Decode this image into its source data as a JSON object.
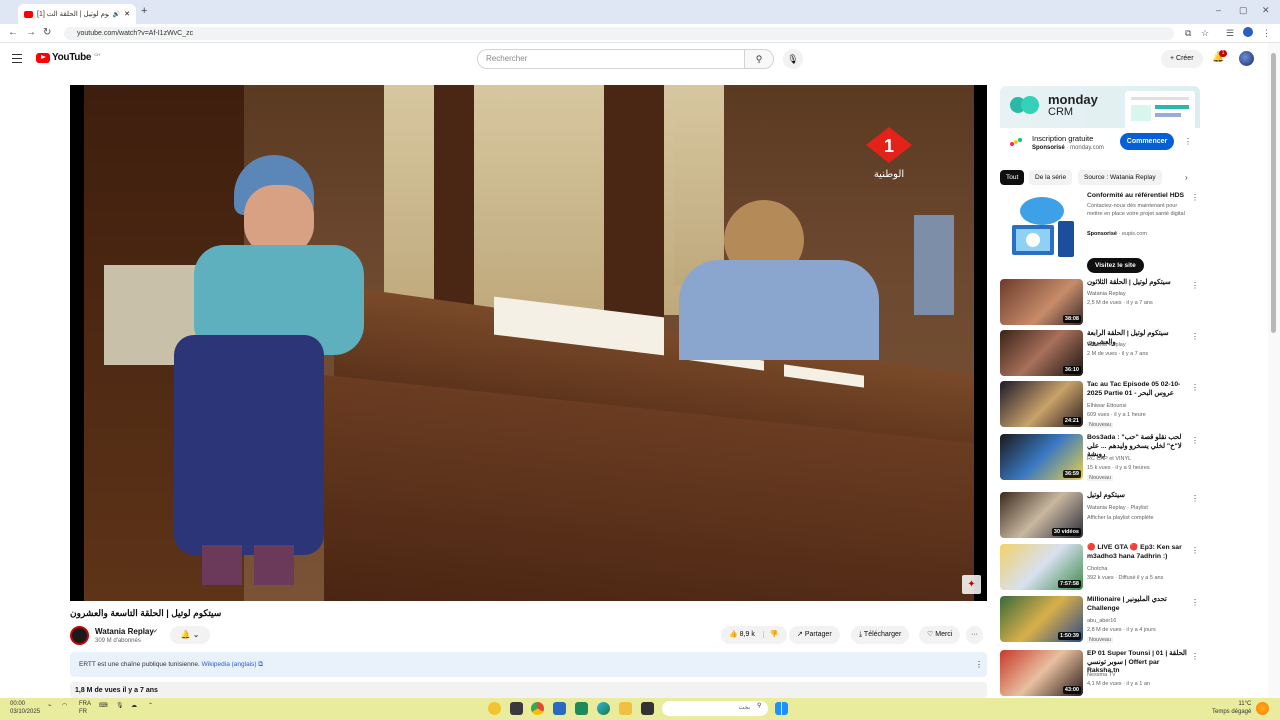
{
  "browser": {
    "tab_title": "[1] سيتكوم لوتيل | الحلقة الت",
    "new_tab": "+",
    "url": "youtube.com/watch?v=Af-I1zWvC_zc",
    "window_controls": [
      "–",
      "▢",
      "✕"
    ]
  },
  "header": {
    "logo_text": "YouTube",
    "logo_suffix": "CH",
    "search_placeholder": "Rechercher",
    "create_label": "+  Créer",
    "notif_count": "1"
  },
  "video": {
    "title": "سيتكوم لوتيل | الحلقة التاسعة والعشرون",
    "channel_logo_glyph": "1",
    "channel_logo_text": "الوطنية",
    "watermark": "✦"
  },
  "channel": {
    "name": "Watania Replay",
    "subscribers": "309 M d'abonnés"
  },
  "actions": {
    "likes": "8,9 k",
    "share": "Partager",
    "download": "Télécharger",
    "thanks": "Merci",
    "more": "···"
  },
  "info_banner": {
    "text": "ERTT est une chaîne publique tunisienne.",
    "link": "Wikipedia (anglais)"
  },
  "description": {
    "stats": "1,8 M de vues  il y a 7 ans"
  },
  "ad": {
    "brand": "monday",
    "brand_sub": "CRM",
    "title": "Inscription gratuite",
    "sponsored": "Sponsorisé",
    "domain": "· monday.com",
    "cta": "Commencer"
  },
  "chips": [
    "Tout",
    "De la série",
    "Source : Watania Replay"
  ],
  "ad2": {
    "title": "Conformité au référentiel HDS",
    "text": "Contactez-nous dès maintenant pour mettre en place votre projet santé digital",
    "sponsored": "Sponsorisé",
    "domain": "· eupis.com",
    "cta": "Visitez le site"
  },
  "recommendations": [
    {
      "title": "سيتكوم لوتيل | الحلقة الثلاثون",
      "channel": "Watania Replay",
      "meta": "2,5 M de vues · il y a 7 ans",
      "duration": "38:08",
      "new": ""
    },
    {
      "title": "سيتكوم لوتيل | الحلقة الرابعة والعشرون",
      "channel": "Watania Replay",
      "meta": "2 M de vues · il y a 7 ans",
      "duration": "36:10",
      "new": ""
    },
    {
      "title": "Tac au Tac Episode 05 02-10-2025 Partie 01 - عروس البحر",
      "channel": "Elhiwar Ettounsi",
      "meta": "609 vues · il y a 1 heure",
      "duration": "24:21",
      "new": "Nouveau"
    },
    {
      "title": "Bos3ada : لحب نقلو قصة \"حب\" لا\"خ\" لخلي يسخرو وليدهم ... علي رويشة",
      "channel": "RC CAP et VINYL",
      "meta": "15 k vues · il y a 9 heures",
      "duration": "36:59",
      "new": "Nouveau"
    },
    {
      "title": "سيتكوم لوتيل",
      "channel": "Watania Replay · Playlist",
      "meta": "Afficher la playlist complète",
      "duration": "30 vidéos",
      "new": ""
    },
    {
      "title": "🔴 LIVE GTA 🔴 Ep3: Ken sar m3adho3 hana 7adhrin :)",
      "channel": "Chotcha",
      "meta": "392 k vues · Diffusé il y a 5 ans",
      "duration": "7:57:58",
      "new": ""
    },
    {
      "title": "Millionaire | تحدي المليونير Challenge",
      "channel": "abu_aber16",
      "meta": "2,8 M de vues · il y a 4 jours",
      "duration": "1:50:39",
      "new": "Nouveau"
    },
    {
      "title": "EP 01 Super Tounsi | 01 الحلقة | سوبر تونسي | Offert par Raksha.tn",
      "channel": "Nessma TV",
      "meta": "4,1 M de vues · il y a 1 an",
      "duration": "43:00",
      "new": ""
    }
  ],
  "taskbar": {
    "time": "00:00",
    "date": "03/10/2025",
    "lang": "FRA",
    "lang2": "FR",
    "search_text": "بحث",
    "weather_temp": "11°C",
    "weather_text": "Temps dégagé"
  },
  "colors": {
    "accent": "#065fd4",
    "brand_red": "#ff0000",
    "taskbar": "#e8ec9c"
  }
}
